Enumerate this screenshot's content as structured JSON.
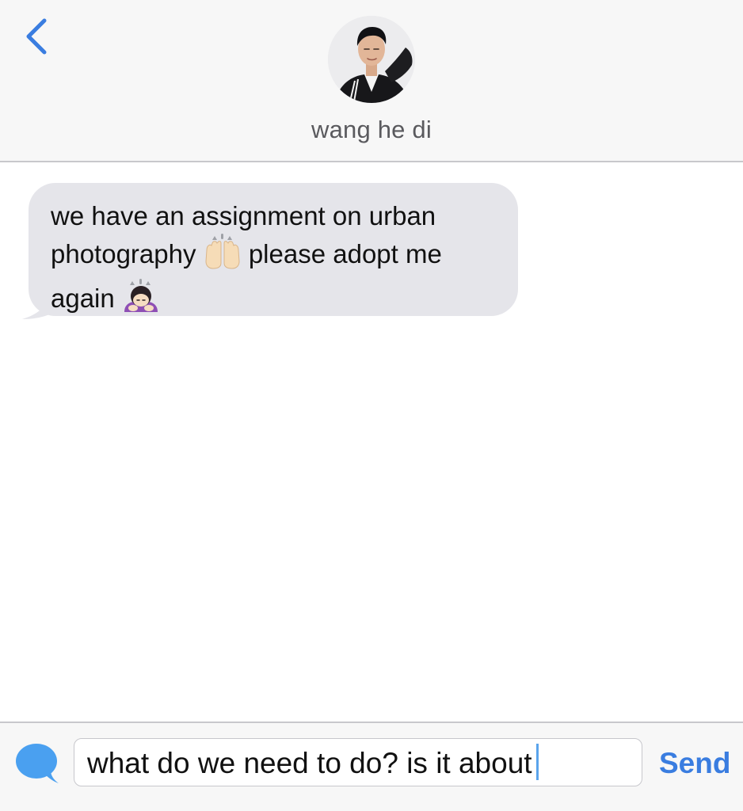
{
  "header": {
    "back_icon": "chevron-left-icon",
    "contact_name": "wang he di"
  },
  "conversation": {
    "messages": [
      {
        "direction": "incoming",
        "text_part_1": "we have an assignment on urban photography",
        "emoji_1": "raising-hands-icon",
        "text_part_2": "please adopt me again",
        "emoji_2": "person-bowing-icon"
      }
    ]
  },
  "composer": {
    "chat_icon": "chat-bubble-icon",
    "draft_text": "what do we need to do? is it about",
    "send_label": "Send"
  },
  "colors": {
    "accent_blue": "#3a7de0",
    "bubble_gray": "#e5e5ea",
    "header_bg": "#f7f7f7"
  }
}
